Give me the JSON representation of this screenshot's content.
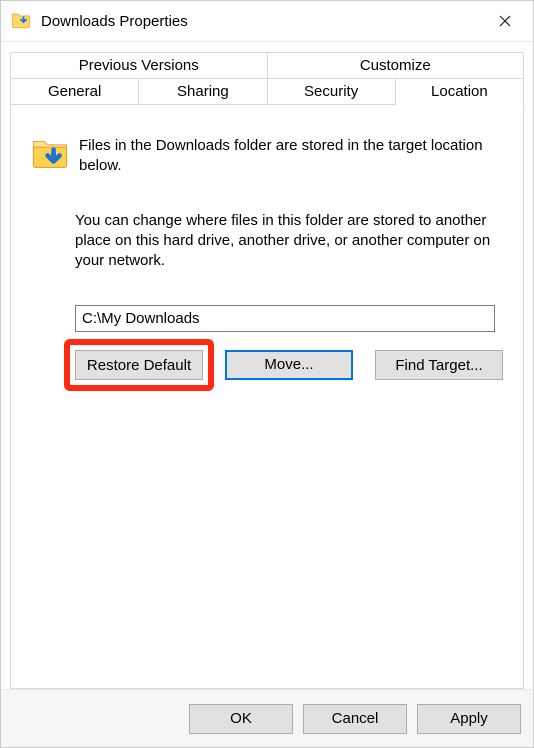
{
  "window": {
    "title": "Downloads Properties"
  },
  "tabs": {
    "row1": [
      {
        "label": "Previous Versions"
      },
      {
        "label": "Customize"
      }
    ],
    "row2": [
      {
        "label": "General"
      },
      {
        "label": "Sharing"
      },
      {
        "label": "Security"
      },
      {
        "label": "Location",
        "active": true
      }
    ]
  },
  "location": {
    "intro": "Files in the Downloads folder are stored in the target location below.",
    "desc": "You can change where files in this folder are stored to another place on this hard drive, another drive, or another computer on your network.",
    "path": "C:\\My Downloads",
    "restore_label": "Restore Default",
    "move_label": "Move...",
    "findtarget_label": "Find Target..."
  },
  "footer": {
    "ok": "OK",
    "cancel": "Cancel",
    "apply": "Apply"
  }
}
